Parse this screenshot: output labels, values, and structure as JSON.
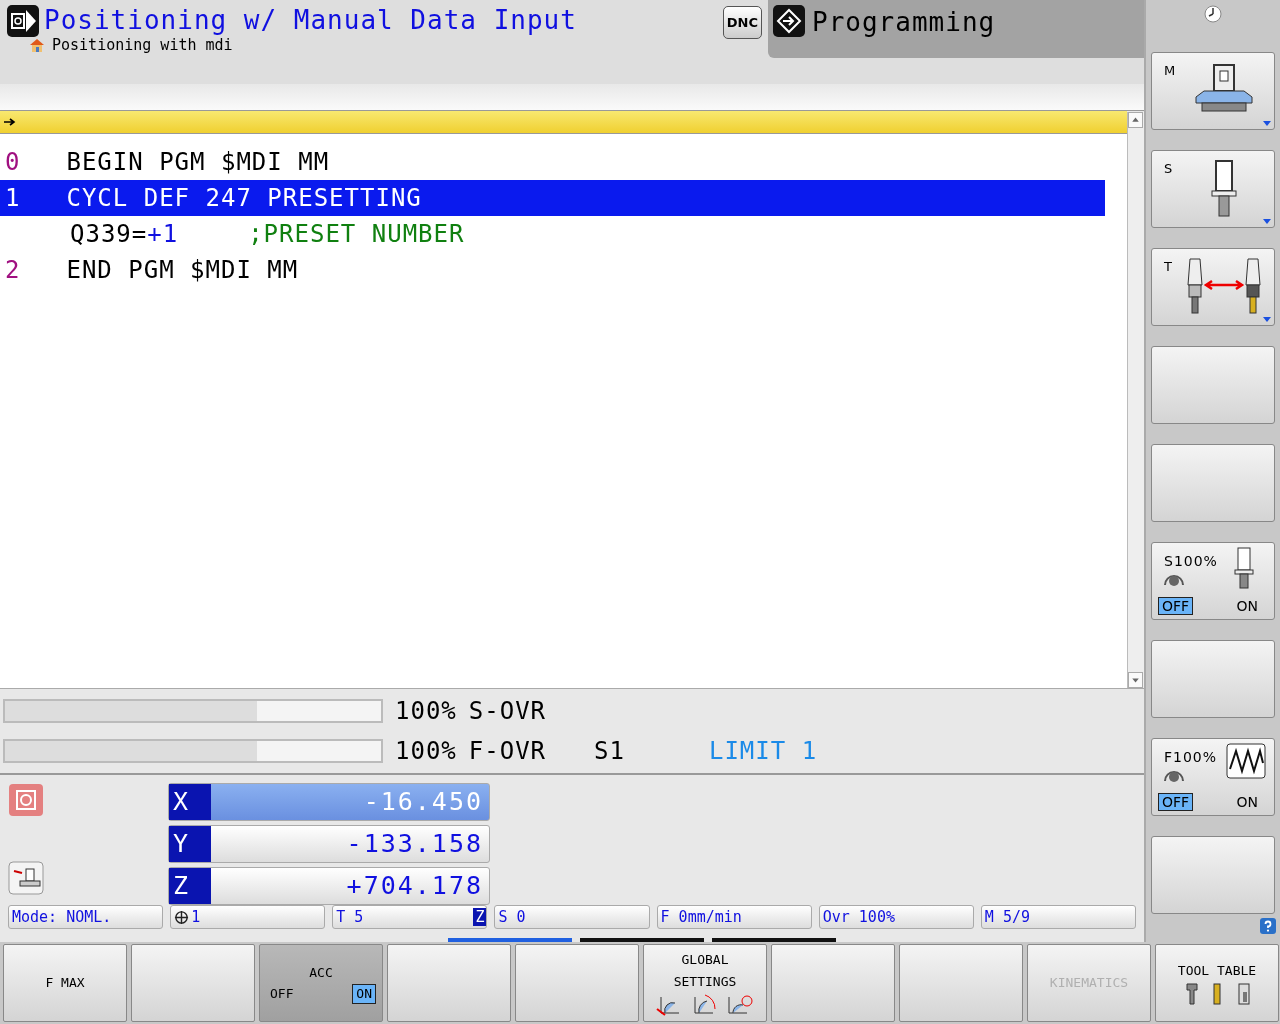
{
  "header": {
    "mode_title": "Positioning w/ Manual Data Input",
    "program_name": "Positioning with mdi",
    "dnc_label": "DNC",
    "other_mode": "Programming"
  },
  "program": {
    "lines": [
      {
        "kind": "block",
        "number": "0",
        "text": "BEGIN PGM $MDI MM",
        "selected": false
      },
      {
        "kind": "block",
        "number": "1",
        "text": "CYCL DEF 247 PRESETTING",
        "selected": true
      },
      {
        "kind": "param",
        "param": "Q339=",
        "value": "+1",
        "comment": ";PRESET NUMBER",
        "selected": false
      },
      {
        "kind": "block",
        "number": "2",
        "text": "END PGM $MDI MM",
        "selected": false
      }
    ]
  },
  "overrides": [
    {
      "level": 0.67,
      "reading": "100%",
      "label": "S-OVR"
    },
    {
      "level": 0.67,
      "reading": "100%",
      "label": "F-OVR"
    }
  ],
  "spindle": "S1",
  "limit": "LIMIT 1",
  "axes": [
    {
      "axis": "X",
      "value": "-16.450",
      "selected": true
    },
    {
      "axis": "Y",
      "value": "-133.158",
      "selected": false
    },
    {
      "axis": "Z",
      "value": "+704.178",
      "selected": false
    }
  ],
  "status": [
    {
      "text": "Mode: NOML."
    },
    {
      "kind": "preset",
      "text": "1"
    },
    {
      "text": "T 5",
      "badge": "Z"
    },
    {
      "text": "S 0"
    },
    {
      "text": "F 0mm/min"
    },
    {
      "text": "Ovr 100%"
    },
    {
      "text": "M 5/9"
    }
  ],
  "pages": [
    {
      "selected": true
    },
    {
      "selected": false
    },
    {
      "selected": false
    }
  ],
  "side_keys": [
    {
      "kind": "machine",
      "label": "M"
    },
    {
      "kind": "spindle",
      "label": "S"
    },
    {
      "kind": "toolchange",
      "label": "T"
    },
    {
      "kind": "empty"
    },
    {
      "kind": "empty"
    },
    {
      "kind": "spindle_toggle",
      "label": "S100%",
      "off": "OFF",
      "on_label": "ON",
      "on": false
    },
    {
      "kind": "empty"
    },
    {
      "kind": "feed_toggle",
      "label": "F100%",
      "off": "OFF",
      "on_label": "ON",
      "on": false
    },
    {
      "kind": "empty"
    }
  ],
  "softkeys": [
    {
      "kind": "text",
      "label": "F MAX",
      "disabled": false
    },
    {
      "kind": "empty"
    },
    {
      "kind": "toggle",
      "label": "ACC",
      "off": "OFF",
      "on_label": "ON",
      "on": true
    },
    {
      "kind": "empty"
    },
    {
      "kind": "empty"
    },
    {
      "kind": "global_icons",
      "label": "GLOBAL SETTINGS"
    },
    {
      "kind": "empty"
    },
    {
      "kind": "empty"
    },
    {
      "kind": "text",
      "label": "KINEMATICS",
      "disabled": true
    },
    {
      "kind": "tool_icons",
      "label": "TOOL TABLE"
    }
  ]
}
